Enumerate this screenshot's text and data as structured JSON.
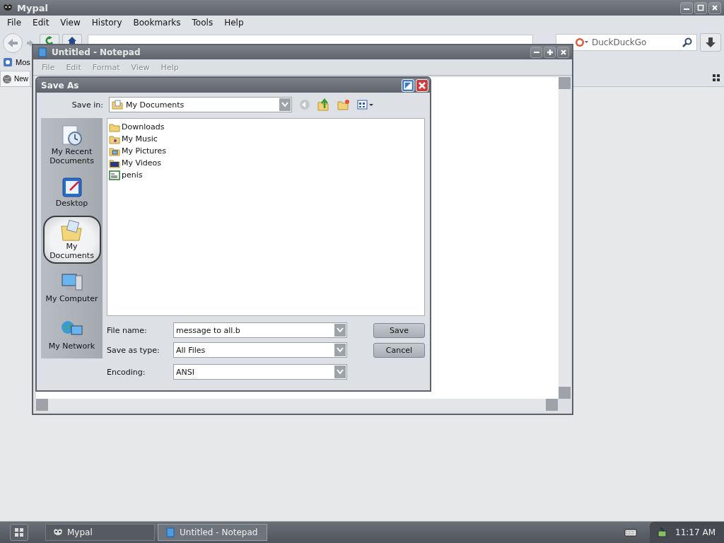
{
  "browser": {
    "title": "Mypal",
    "menu": [
      "File",
      "Edit",
      "View",
      "History",
      "Bookmarks",
      "Tools",
      "Help"
    ],
    "search": {
      "placeholder": "DuckDuckGo"
    },
    "bookmarks": [
      "Mos"
    ],
    "tabs": [
      {
        "label": "New",
        "selected": true
      }
    ]
  },
  "notepad": {
    "title": "Untitled - Notepad",
    "menu": [
      {
        "label": "File",
        "disabled": true
      },
      {
        "label": "Edit",
        "disabled": true
      },
      {
        "label": "Format",
        "disabled": true
      },
      {
        "label": "View",
        "disabled": true
      },
      {
        "label": "Help",
        "disabled": true
      }
    ]
  },
  "save_as": {
    "title": "Save As",
    "save_in": {
      "label": "Save in:",
      "value": "My Documents"
    },
    "places": [
      {
        "label": "My Recent Documents",
        "kind": "recent",
        "selected": false
      },
      {
        "label": "Desktop",
        "kind": "desktop",
        "selected": false
      },
      {
        "label": "My Documents",
        "kind": "documents",
        "selected": true
      },
      {
        "label": "My Computer",
        "kind": "computer",
        "selected": false
      },
      {
        "label": "My Network",
        "kind": "network",
        "selected": false
      }
    ],
    "files": [
      {
        "name": "Downloads",
        "kind": "folder"
      },
      {
        "name": "My Music",
        "kind": "music"
      },
      {
        "name": "My Pictures",
        "kind": "pictures"
      },
      {
        "name": "My Videos",
        "kind": "videos"
      },
      {
        "name": "penis",
        "kind": "text"
      }
    ],
    "fields": [
      {
        "label": "File name:",
        "value": "message to all.b"
      },
      {
        "label": "Save as type:",
        "value": "All Files"
      },
      {
        "label": "Encoding:",
        "value": "ANSI"
      }
    ],
    "buttons": [
      "Save",
      "Cancel"
    ]
  },
  "taskbar": {
    "tasks": [
      {
        "label": "Mypal",
        "selected": false
      },
      {
        "label": "Untitled - Notepad",
        "selected": true
      }
    ],
    "clock": "11:17 AM"
  }
}
